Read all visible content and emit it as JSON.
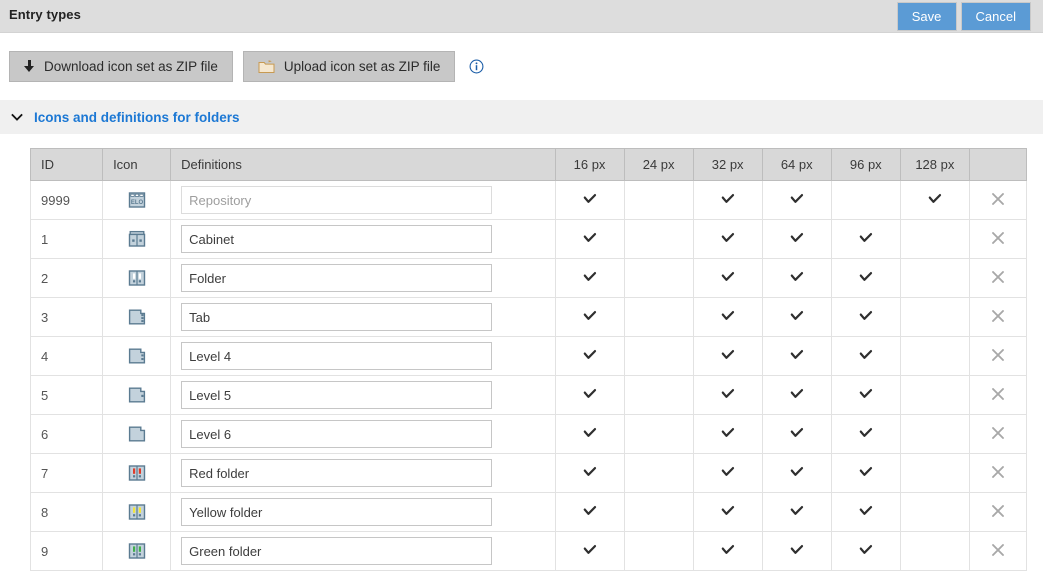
{
  "topbar": {
    "title": "Entry types",
    "save_label": "Save",
    "cancel_label": "Cancel"
  },
  "toolbar": {
    "download_label": "Download icon set as ZIP file",
    "upload_label": "Upload icon set as ZIP file",
    "download_icon": "download-arrow-icon",
    "upload_icon": "upload-folder-icon",
    "info_icon": "info-circle-icon"
  },
  "section": {
    "title": "Icons and definitions for folders",
    "chevron_icon": "chevron-down-icon",
    "expanded": true
  },
  "colors": {
    "accent_blue": "#5b9bd5",
    "link_blue": "#1c78d4",
    "topbar_bg": "#dddddd",
    "section_bg": "#f0f0f0",
    "table_header_bg": "#d8d8d8",
    "icon_outline": "#5b7b91",
    "icon_fill": "#c3d2dc",
    "red": "#e03c2a",
    "yellow": "#f2e53a",
    "green": "#3fae4a"
  },
  "table": {
    "columns": [
      "ID",
      "Icon",
      "Definitions",
      "16 px",
      "24 px",
      "32 px",
      "64 px",
      "96 px",
      "128 px",
      ""
    ],
    "size_columns": [
      "16 px",
      "24 px",
      "32 px",
      "64 px",
      "96 px",
      "128 px"
    ],
    "delete_icon": "close-x-icon",
    "check_icon": "check-icon",
    "rows": [
      {
        "id": "9999",
        "icon": "repository-elo-icon",
        "definition": "",
        "placeholder": "Repository",
        "sizes": [
          true,
          false,
          true,
          true,
          false,
          true
        ]
      },
      {
        "id": "1",
        "icon": "cabinet-icon",
        "definition": "Cabinet",
        "placeholder": "",
        "sizes": [
          true,
          false,
          true,
          true,
          true,
          false
        ]
      },
      {
        "id": "2",
        "icon": "folder-icon",
        "definition": "Folder",
        "placeholder": "",
        "sizes": [
          true,
          false,
          true,
          true,
          true,
          false
        ]
      },
      {
        "id": "3",
        "icon": "tab-icon",
        "definition": "Tab",
        "placeholder": "",
        "sizes": [
          true,
          false,
          true,
          true,
          true,
          false
        ]
      },
      {
        "id": "4",
        "icon": "level4-icon",
        "definition": "Level 4",
        "placeholder": "",
        "sizes": [
          true,
          false,
          true,
          true,
          true,
          false
        ]
      },
      {
        "id": "5",
        "icon": "level5-icon",
        "definition": "Level 5",
        "placeholder": "",
        "sizes": [
          true,
          false,
          true,
          true,
          true,
          false
        ]
      },
      {
        "id": "6",
        "icon": "level6-icon",
        "definition": "Level 6",
        "placeholder": "",
        "sizes": [
          true,
          false,
          true,
          true,
          true,
          false
        ]
      },
      {
        "id": "7",
        "icon": "red-folder-icon",
        "definition": "Red folder",
        "placeholder": "",
        "sizes": [
          true,
          false,
          true,
          true,
          true,
          false
        ]
      },
      {
        "id": "8",
        "icon": "yellow-folder-icon",
        "definition": "Yellow folder",
        "placeholder": "",
        "sizes": [
          true,
          false,
          true,
          true,
          true,
          false
        ]
      },
      {
        "id": "9",
        "icon": "green-folder-icon",
        "definition": "Green folder",
        "placeholder": "",
        "sizes": [
          true,
          false,
          true,
          true,
          true,
          false
        ]
      }
    ]
  }
}
